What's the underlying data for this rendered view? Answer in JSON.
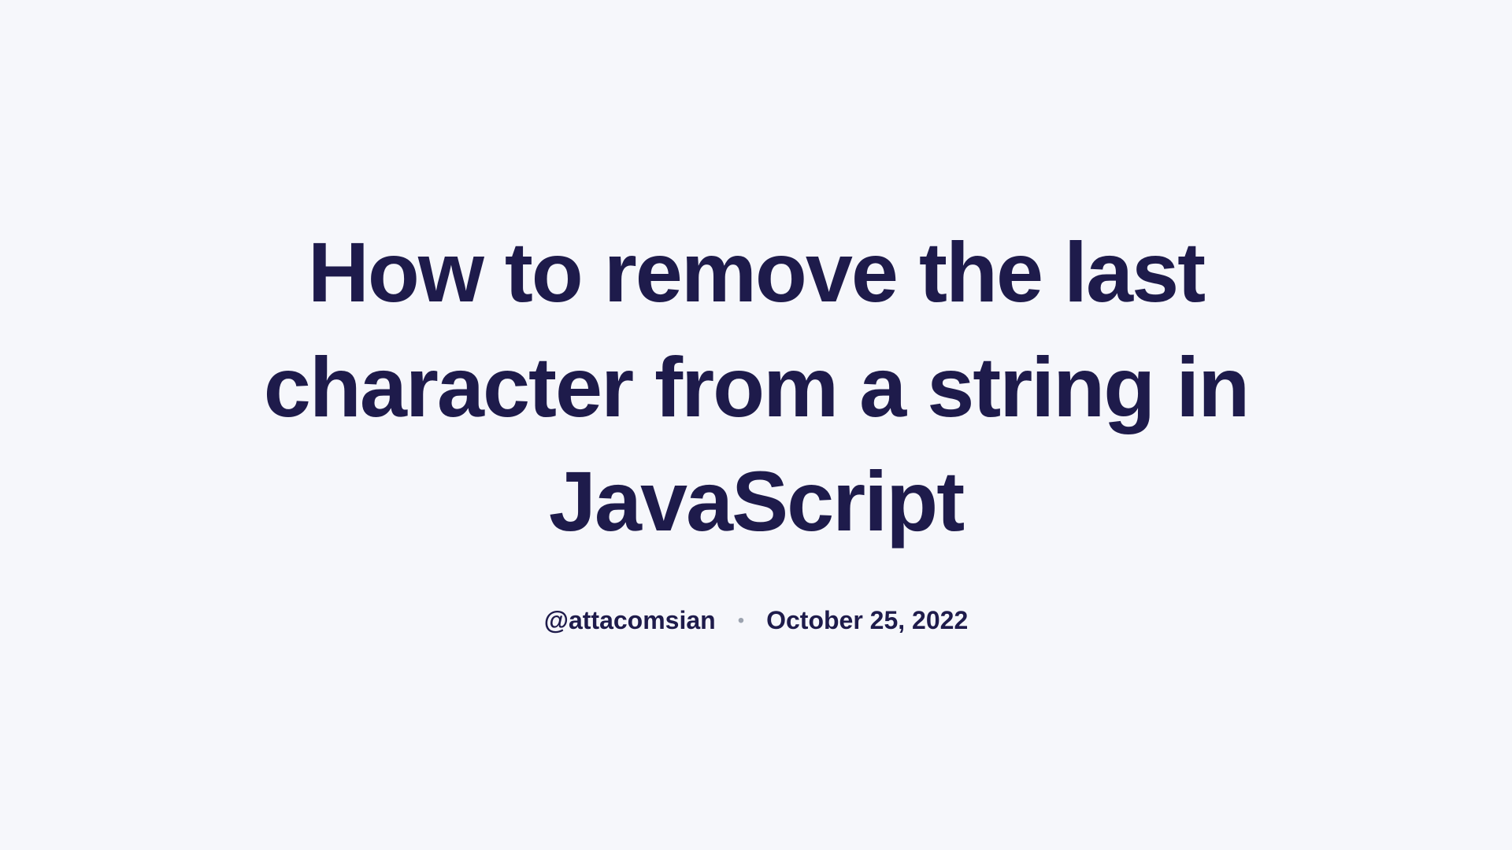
{
  "title": "How to remove the last character from a string in JavaScript",
  "author": "@attacomsian",
  "date": "October 25, 2022"
}
